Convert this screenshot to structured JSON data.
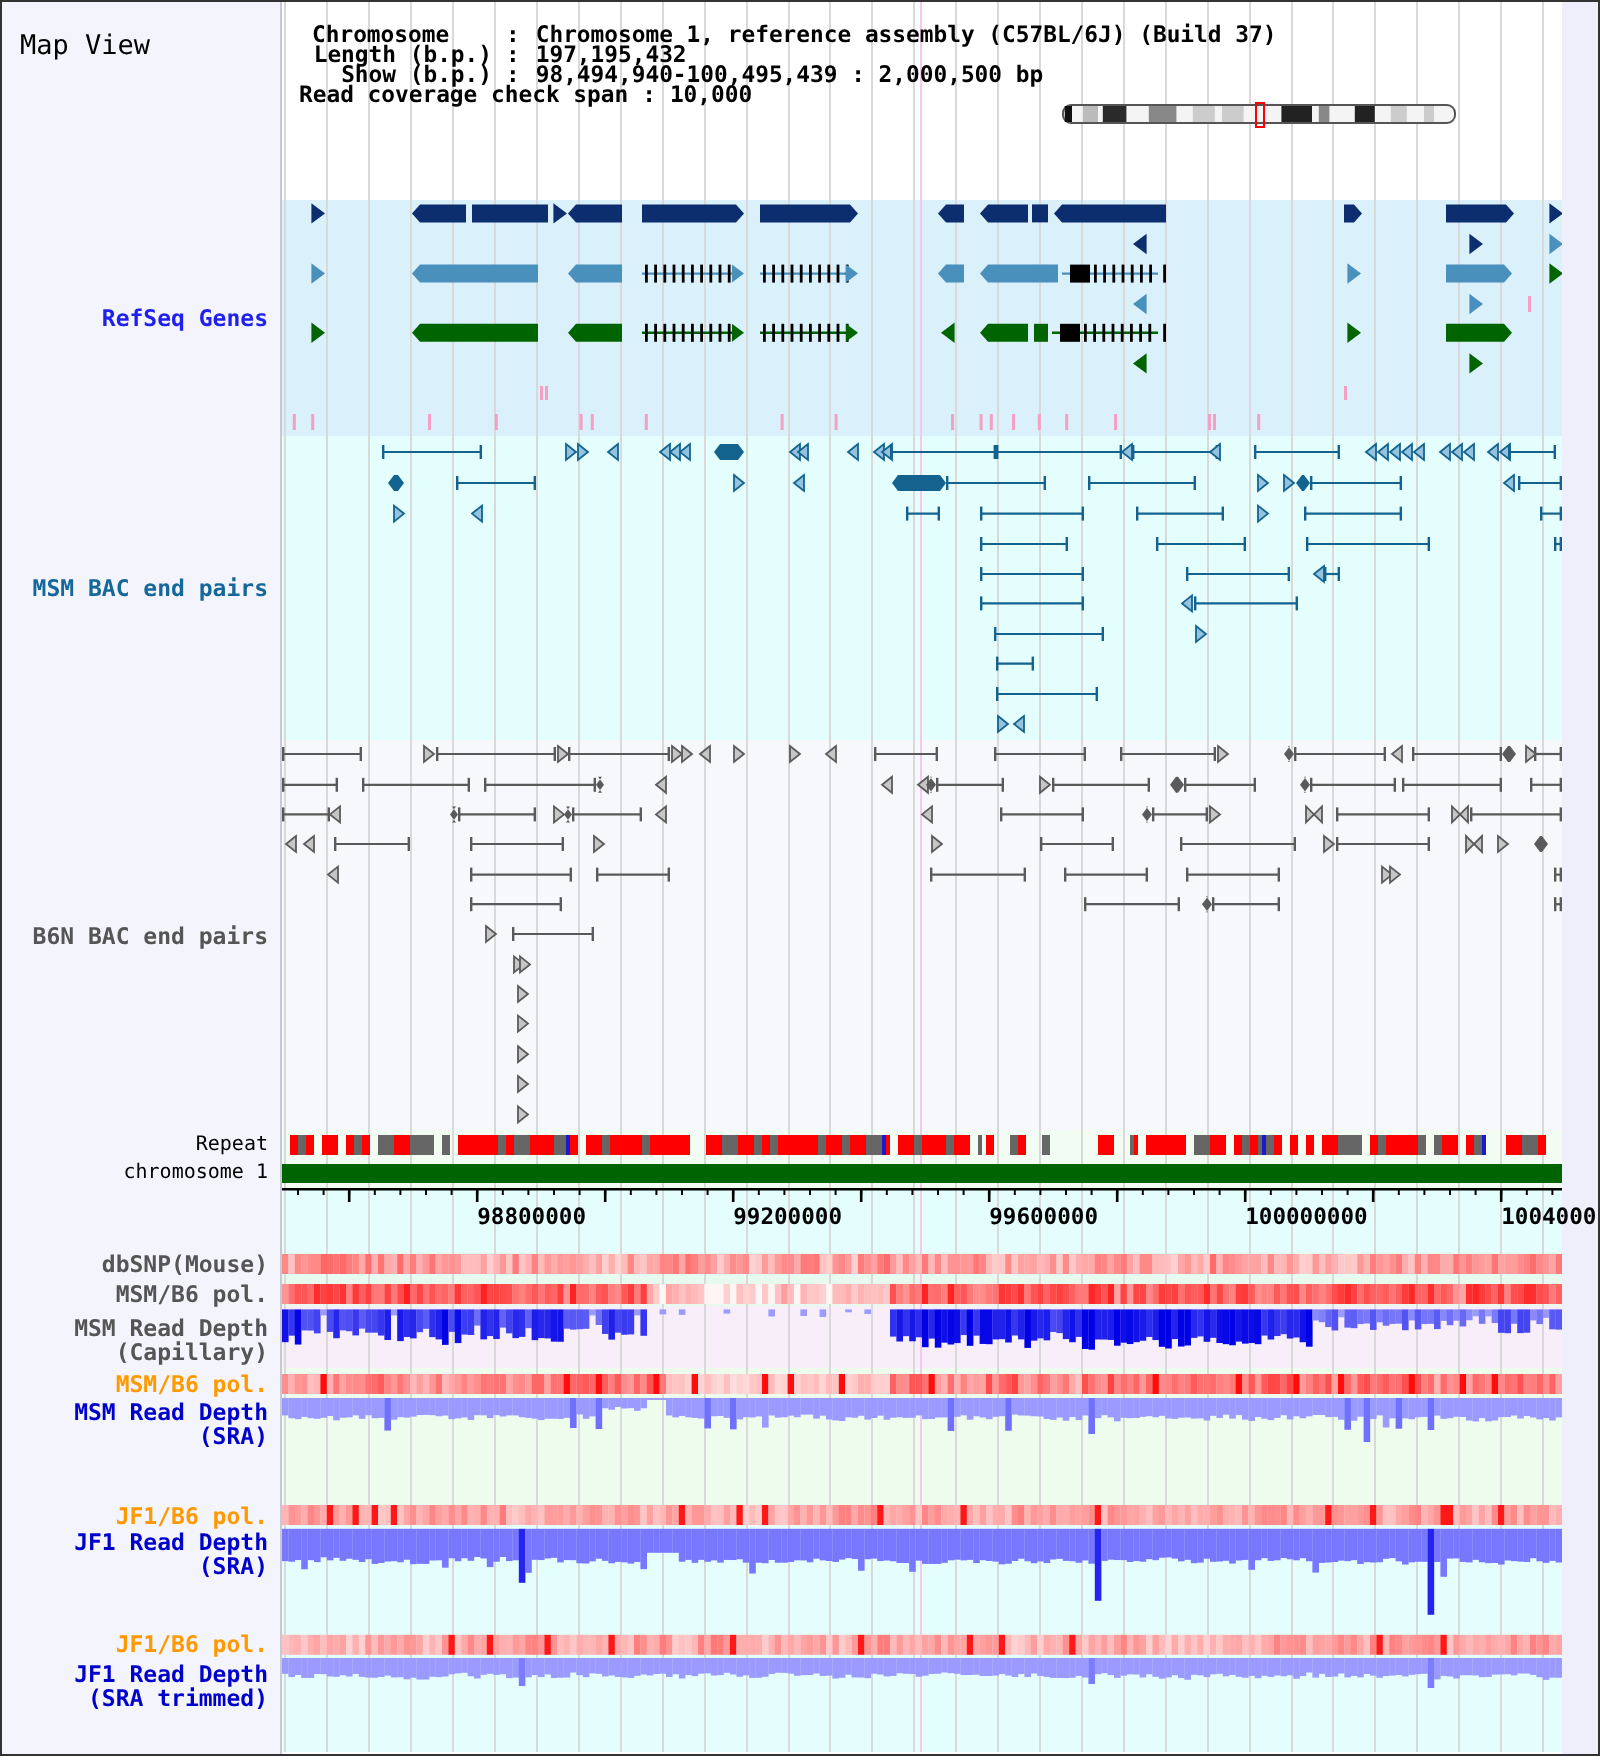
{
  "header": {
    "title": "Map View",
    "info": [
      {
        "label": "Chromosome",
        "separator": ":",
        "value": "Chromosome 1, reference assembly (C57BL/6J) (Build 37)"
      },
      {
        "label": "Length (b.p.)",
        "separator": ":",
        "value": "197,195,432"
      },
      {
        "label": "Show (b.p.)",
        "separator": ":",
        "value": "98,494,940-100,495,439 : 2,000,500 bp"
      }
    ],
    "coverage_span": {
      "label": "Read coverage check span",
      "separator": ":",
      "value": "10,000"
    }
  },
  "tracks": [
    {
      "kind": "genes",
      "label": "RefSeq Genes",
      "color": "#2020ee"
    },
    {
      "kind": "bac",
      "label": "MSM BAC end pairs",
      "color": "#16679a"
    },
    {
      "kind": "bac",
      "label": "B6N BAC end pairs",
      "color": "#555555"
    },
    {
      "kind": "repeat",
      "label": "Repeat",
      "color": "#000000"
    },
    {
      "kind": "chromosome",
      "label": "chromosome 1",
      "color": "#000000"
    },
    {
      "kind": "axis",
      "tick_labels": [
        "98800000",
        "99200000",
        "99600000",
        "100000000",
        "1004000"
      ]
    },
    {
      "kind": "heat",
      "label": "dbSNP(Mouse)",
      "color": "#555555"
    },
    {
      "kind": "heat",
      "label": "MSM/B6 pol.",
      "color": "#555555"
    },
    {
      "kind": "depth",
      "label": "MSM Read Depth",
      "sublabel": "(Capillary)",
      "color": "#555555"
    },
    {
      "kind": "heat",
      "label": "MSM/B6 pol.",
      "color": "#ff9900"
    },
    {
      "kind": "depth",
      "label": "MSM Read Depth",
      "sublabel": "(SRA)",
      "color": "#0000cc"
    },
    {
      "kind": "heat",
      "label": "JF1/B6 pol.",
      "color": "#ff9900"
    },
    {
      "kind": "depth",
      "label": "JF1 Read Depth",
      "sublabel": "(SRA)",
      "color": "#0000cc"
    },
    {
      "kind": "heat",
      "label": "JF1/B6 pol.",
      "color": "#ff9900"
    },
    {
      "kind": "depth",
      "label": "JF1 Read Depth",
      "sublabel": "(SRA trimmed)",
      "color": "#0000cc"
    }
  ]
}
